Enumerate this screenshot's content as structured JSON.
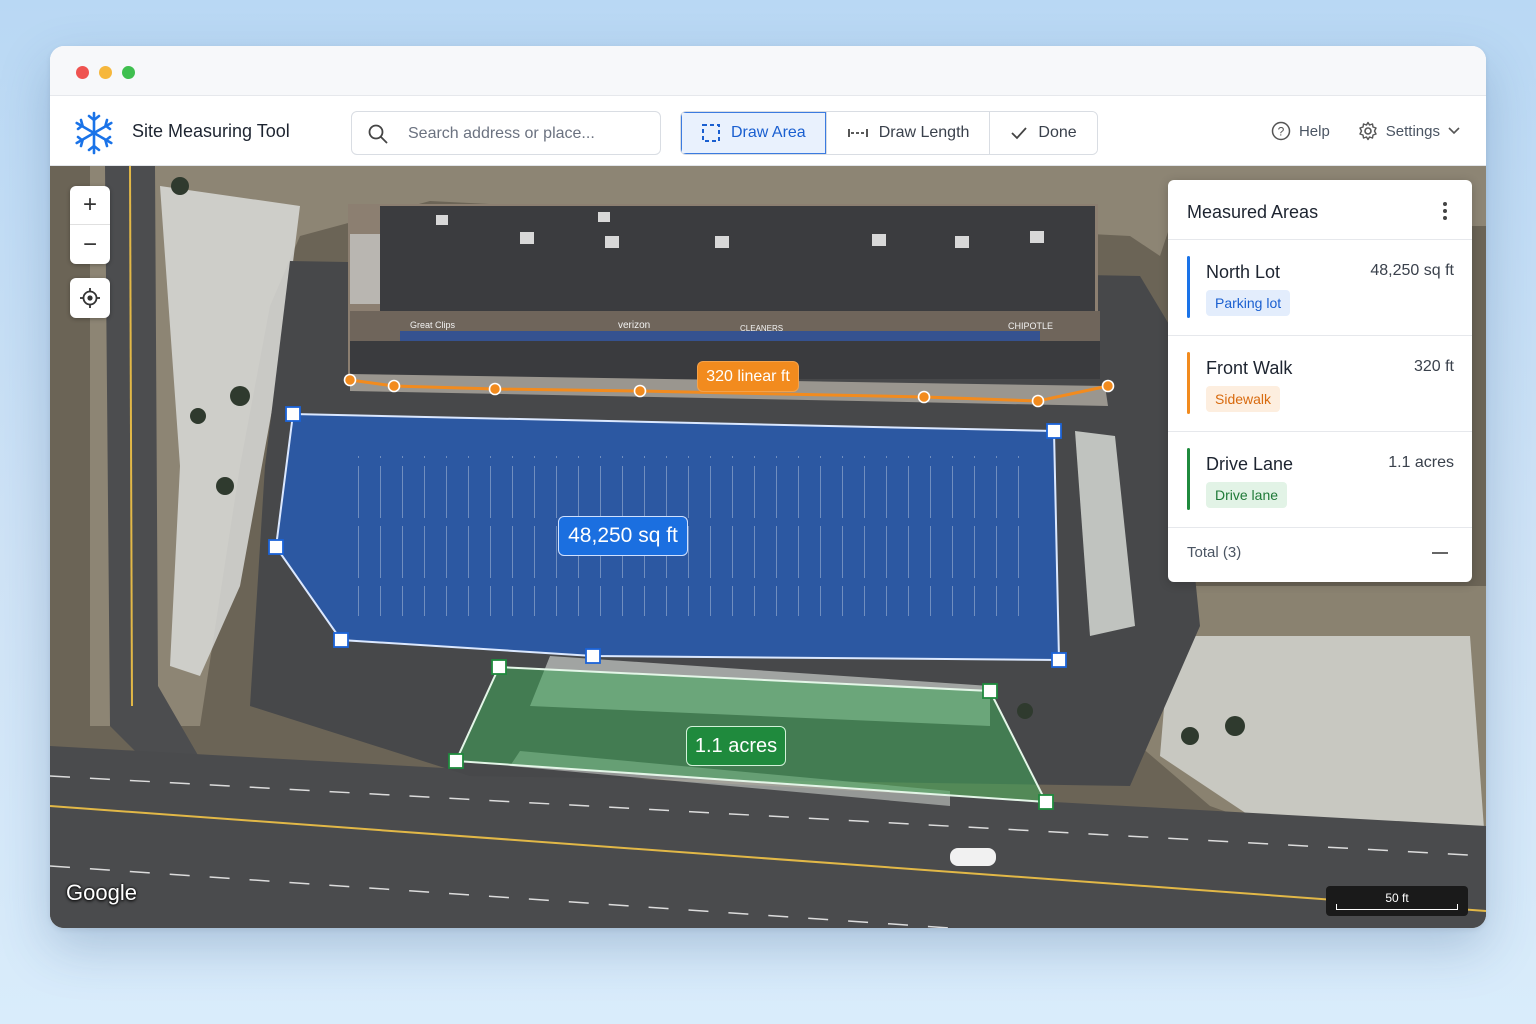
{
  "app": {
    "title": "Site Measuring Tool",
    "brand_icon": "snowflake-icon",
    "brand_color": "#1a73e8"
  },
  "search": {
    "placeholder": "Search address or place..."
  },
  "tools": [
    {
      "label": "Draw Area",
      "icon": "draw-area-icon",
      "active": true
    },
    {
      "label": "Draw Length",
      "icon": "draw-length-icon",
      "active": false
    },
    {
      "label": "Done",
      "icon": "check-icon",
      "active": false
    }
  ],
  "header_right": {
    "help_label": "Help",
    "settings_label": "Settings"
  },
  "map": {
    "labels": {
      "length": "320 linear ft",
      "area": "48,250 sq ft",
      "acres": "1.1 acres"
    },
    "storefront_signs": [
      "Great Clips",
      "verizon",
      "CLEANERS",
      "CHIPOTLE"
    ],
    "attribution": "Google",
    "scale_label": "50 ft",
    "colors": {
      "area": "#1b6fe0",
      "length": "#f28b1e",
      "lane": "#1f8a3d"
    }
  },
  "panel": {
    "title": "Measured Areas",
    "items": [
      {
        "name": "North Lot",
        "value": "48,250 sq ft",
        "tag": "Parking lot",
        "color": "#1a73e8",
        "tag_bg": "#e3edfc",
        "tag_fg": "#1a5fd0"
      },
      {
        "name": "Front Walk",
        "value": "320 ft",
        "tag": "Sidewalk",
        "color": "#f28b1e",
        "tag_bg": "#fdeedf",
        "tag_fg": "#d86a0e"
      },
      {
        "name": "Drive Lane",
        "value": "1.1 acres",
        "tag": "Drive lane",
        "color": "#1f8a3d",
        "tag_bg": "#e2f3e6",
        "tag_fg": "#1f7a38"
      }
    ],
    "total_label": "Total (3)"
  }
}
